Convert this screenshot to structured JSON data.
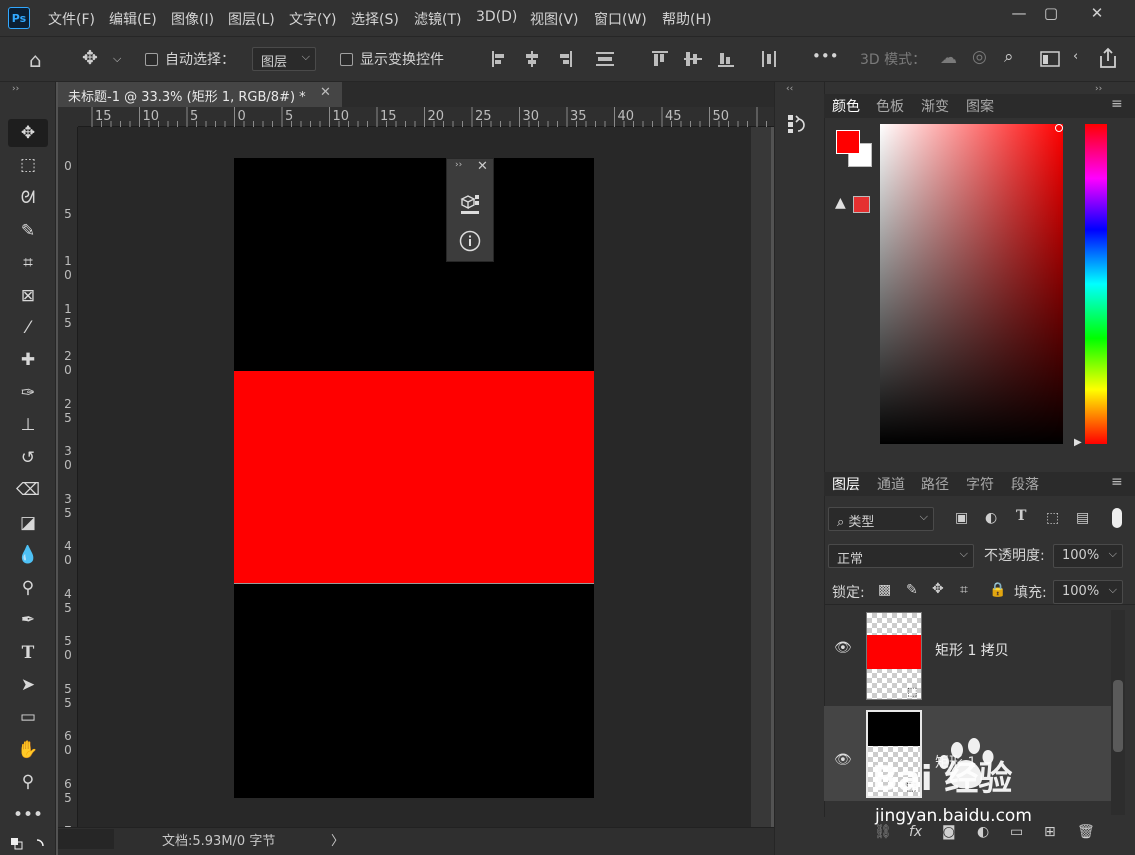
{
  "app": {
    "logo": "Ps"
  },
  "menu": [
    "文件(F)",
    "编辑(E)",
    "图像(I)",
    "图层(L)",
    "文字(Y)",
    "选择(S)",
    "滤镜(T)",
    "3D(D)",
    "视图(V)",
    "窗口(W)",
    "帮助(H)"
  ],
  "window_controls": {
    "minimize": "—",
    "maximize": "▢",
    "close": "✕"
  },
  "options": {
    "auto_select_label": "自动选择：",
    "auto_select_target": "图层",
    "show_transform_label": "显示变换控件",
    "more": "•••",
    "mode_3d_label": "3D 模式："
  },
  "document": {
    "tab_title": "未标题-1 @ 33.3% (矩形 1, RGB/8#) *",
    "status": "文档:5.93M/0 字节",
    "status_arrow": "〉"
  },
  "rulers": {
    "top": [
      "15",
      "10",
      "5",
      "0",
      "5",
      "10",
      "15",
      "20",
      "25",
      "30",
      "35",
      "40",
      "45",
      "50"
    ],
    "left": [
      "0",
      "5",
      "1\n0",
      "1\n5",
      "2\n0",
      "2\n5",
      "3\n0",
      "3\n5",
      "4\n0",
      "4\n5",
      "5\n0",
      "5\n5",
      "6\n0",
      "6\n5",
      "7"
    ]
  },
  "color_panel": {
    "tabs": [
      "颜色",
      "色板",
      "渐变",
      "图案"
    ],
    "active_tab": "颜色",
    "foreground": "#ff0000",
    "background": "#ffffff",
    "gamut_warning_icon": "warning-icon"
  },
  "layers_panel": {
    "tabs": [
      "图层",
      "通道",
      "路径",
      "字符",
      "段落"
    ],
    "active_tab": "图层",
    "filter_kind": "类型",
    "blend_mode": "正常",
    "opacity_label": "不透明度:",
    "opacity": "100%",
    "lock_label": "锁定:",
    "fill_label": "填充:",
    "fill": "100%",
    "layers": [
      {
        "name": "矩形 1 拷贝",
        "fill": "#ff0000",
        "visible": true,
        "selected": false
      },
      {
        "name": "矩形 1",
        "fill": "#000000",
        "visible": true,
        "selected": true
      }
    ]
  },
  "watermark": {
    "brand": "Bai 经验",
    "url": "jingyan.baidu.com"
  },
  "colors": {
    "accent": "#31a8ff",
    "shape_red": "#ff0000",
    "panel_bg": "#323232",
    "canvas_bg": "#282828"
  }
}
